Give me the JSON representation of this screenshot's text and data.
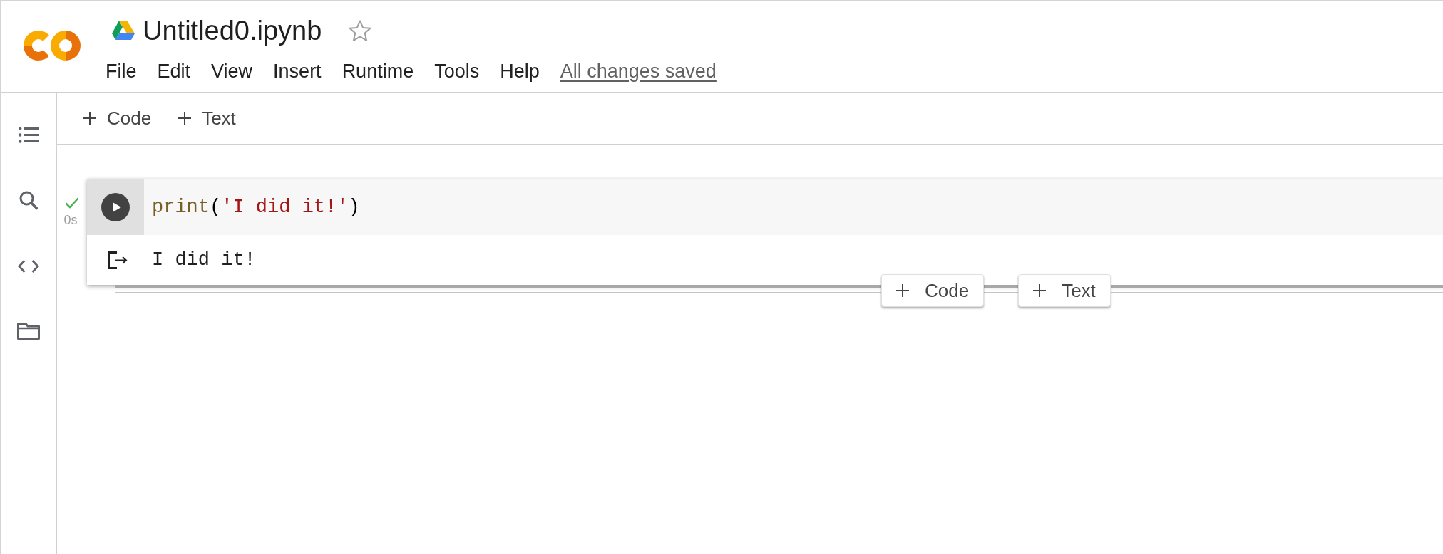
{
  "header": {
    "title": "Untitled0.ipynb",
    "starred": false,
    "menu": [
      "File",
      "Edit",
      "View",
      "Insert",
      "Runtime",
      "Tools",
      "Help"
    ],
    "save_status": "All changes saved"
  },
  "toolbar": {
    "buttons": [
      {
        "label": "Code"
      },
      {
        "label": "Text"
      }
    ]
  },
  "cell": {
    "executed": true,
    "duration": "0s",
    "code": [
      {
        "kind": "function",
        "text": "print"
      },
      {
        "kind": "punct",
        "text": "("
      },
      {
        "kind": "string",
        "text": "'I did it!'"
      },
      {
        "kind": "punct",
        "text": ")"
      }
    ],
    "output": "I did it!"
  },
  "insert_buttons": [
    {
      "label": "Code"
    },
    {
      "label": "Text"
    }
  ]
}
